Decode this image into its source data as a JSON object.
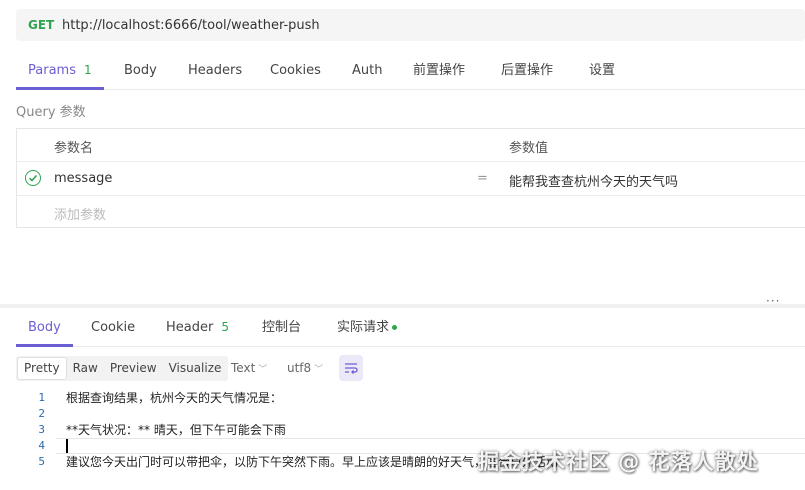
{
  "request": {
    "method": "GET",
    "url": "http://localhost:6666/tool/weather-push"
  },
  "request_tabs": {
    "params": "Params",
    "params_count": "1",
    "body": "Body",
    "headers": "Headers",
    "cookies": "Cookies",
    "auth": "Auth",
    "pre_script": "前置操作",
    "post_script": "后置操作",
    "settings": "设置"
  },
  "query": {
    "section_label": "Query 参数",
    "col_name": "参数名",
    "col_value": "参数值",
    "rows": [
      {
        "enabled": true,
        "name": "message",
        "separator": "=",
        "value": "能帮我查查杭州今天的天气吗"
      }
    ],
    "add_placeholder": "添加参数"
  },
  "response_tabs": {
    "body": "Body",
    "cookie": "Cookie",
    "header": "Header",
    "header_count": "5",
    "console": "控制台",
    "actual_request": "实际请求"
  },
  "view_modes": {
    "pretty": "Pretty",
    "raw": "Raw",
    "preview": "Preview",
    "visualize": "Visualize",
    "format": "Text",
    "encoding": "utf8"
  },
  "response_body": {
    "lines": [
      {
        "num": "1",
        "text": "根据查询结果，杭州今天的天气情况是："
      },
      {
        "num": "2",
        "text": ""
      },
      {
        "num": "3",
        "text": "**天气状况：** 晴天，但下午可能会下雨"
      },
      {
        "num": "4",
        "text": ""
      },
      {
        "num": "5",
        "text": "建议您今天出门时可以带把伞，以防下午突然下雨。早上应该是晴朗的好天气，适合户外活动"
      }
    ]
  },
  "watermark": "掘金技术社区 @ 花落人散处",
  "colors": {
    "accent": "#6b5fd4",
    "success": "#2ea44f"
  }
}
